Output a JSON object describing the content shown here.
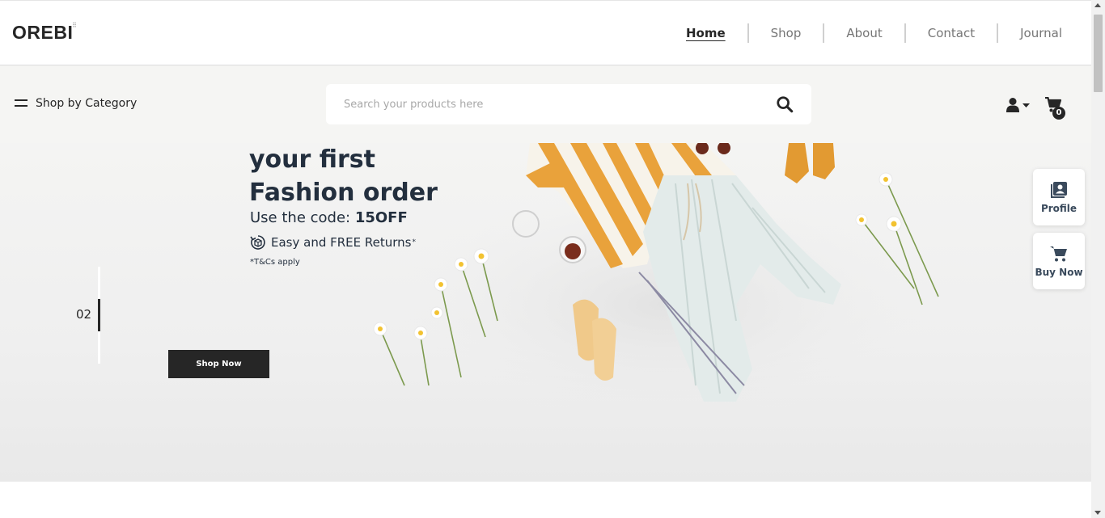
{
  "brand": {
    "logo": "OREBI",
    "logo_mark": "⠿"
  },
  "nav": {
    "items": [
      {
        "label": "Home",
        "active": true
      },
      {
        "label": "Shop",
        "active": false
      },
      {
        "label": "About",
        "active": false
      },
      {
        "label": "Contact",
        "active": false
      },
      {
        "label": "Journal",
        "active": false
      }
    ]
  },
  "subheader": {
    "category_label": "Shop by Category",
    "search_placeholder": "Search your products here",
    "cart_count": "0"
  },
  "banner": {
    "headline_line1": "your first",
    "headline_line2": "Fashion order",
    "code_prefix": "Use the code: ",
    "code": "15OFF",
    "returns": "Easy and FREE Returns",
    "returns_mark": "*",
    "tcs": "*T&Cs apply",
    "slide_number": "02",
    "cta": "Shop Now"
  },
  "side_actions": {
    "profile": "Profile",
    "buy_now": "Buy Now"
  },
  "colors": {
    "dark": "#262626",
    "banner_bg": "#f0f0ef",
    "text_navy": "#232f3e",
    "accent_orange": "#e8a03a"
  }
}
